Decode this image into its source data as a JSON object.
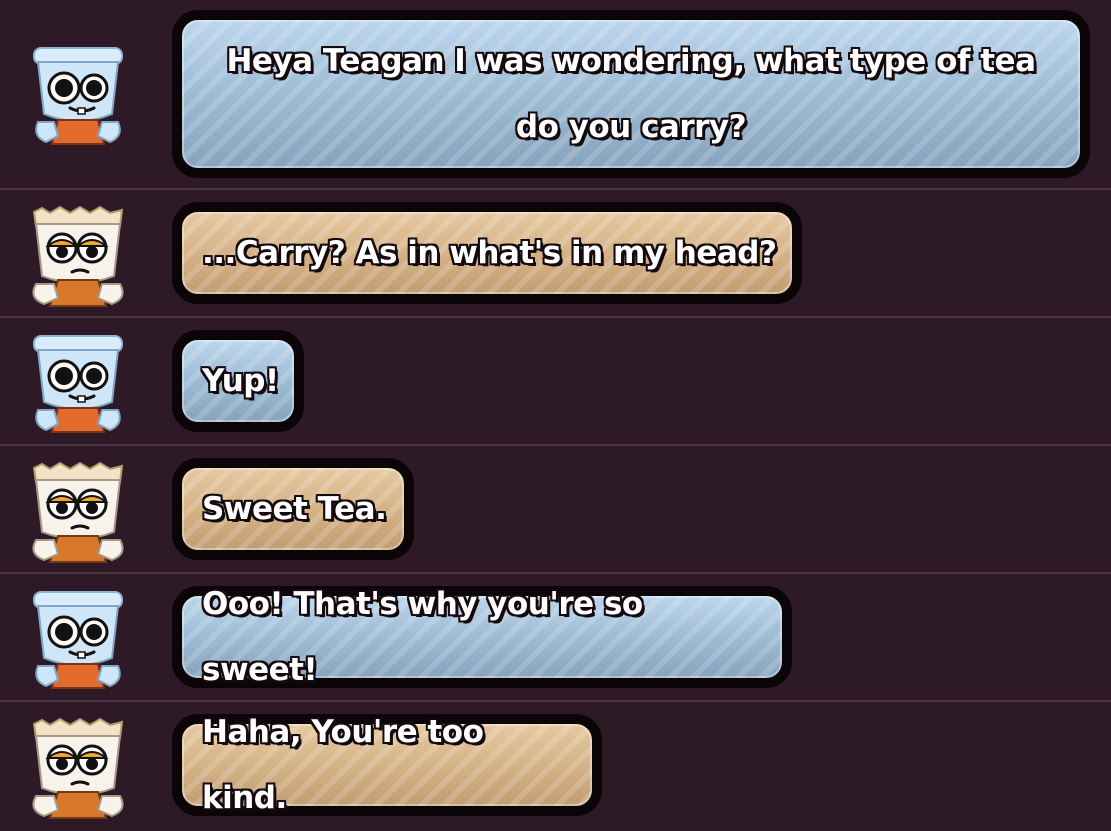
{
  "characters": {
    "left_blue": {
      "name_icon": "blue-teacup-character-icon",
      "color": "#bcd6ec"
    },
    "right_tan": {
      "name_icon": "tan-teacup-character-icon",
      "color": "#e6c9a0"
    }
  },
  "messages": [
    {
      "speaker": "blue",
      "text": "Heya Teagan I was wondering, what type of tea do you carry?"
    },
    {
      "speaker": "tan",
      "text": "...Carry? As in what's in my head?"
    },
    {
      "speaker": "blue",
      "text": "Yup!"
    },
    {
      "speaker": "tan",
      "text": "Sweet Tea."
    },
    {
      "speaker": "blue",
      "text": "Ooo! That's why you're so sweet!"
    },
    {
      "speaker": "tan",
      "text": "Haha, You're too kind."
    }
  ],
  "colors": {
    "background": "#2e1927",
    "divider": "#4a3440",
    "bubble_border": "#0c0508"
  }
}
